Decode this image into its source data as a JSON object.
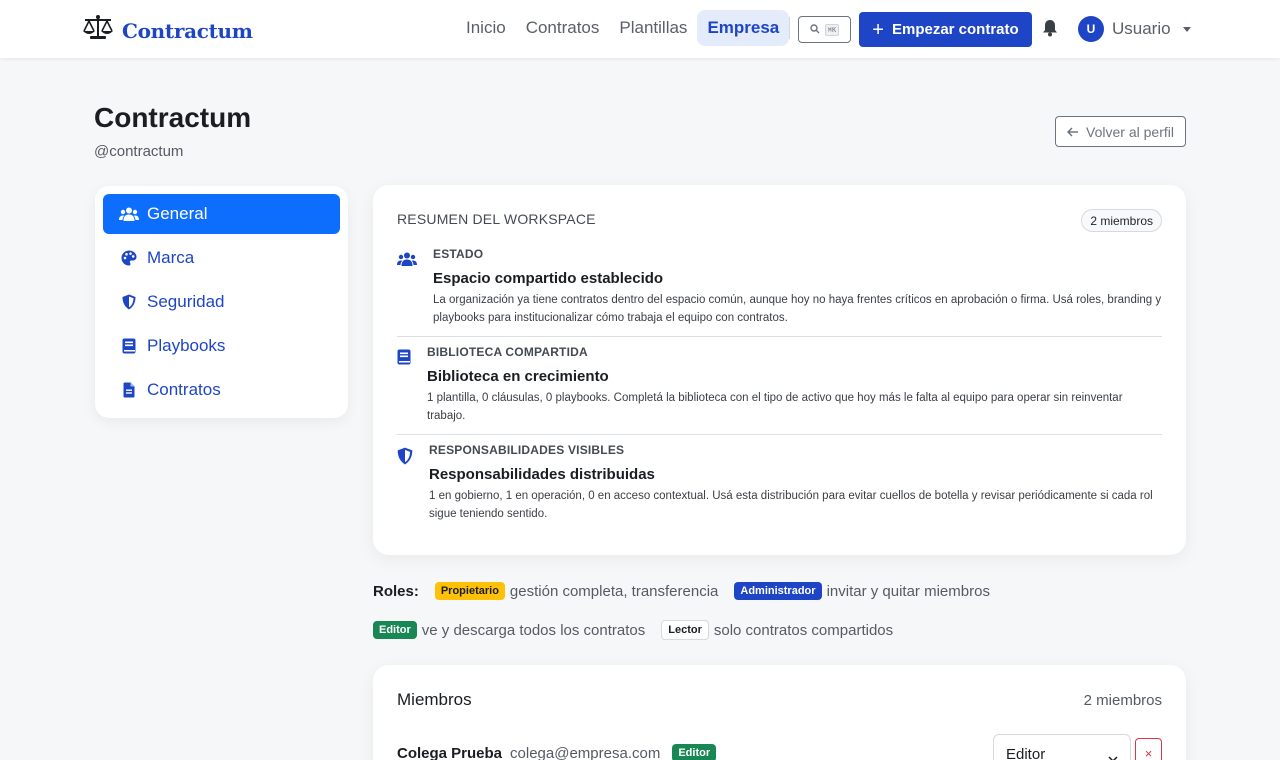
{
  "brand": {
    "name": "Contractum",
    "icon": "scales-icon",
    "color": "#1f45c7"
  },
  "nav": {
    "links": [
      {
        "label": "Inicio",
        "active": false
      },
      {
        "label": "Contratos",
        "active": false
      },
      {
        "label": "Plantillas",
        "active": false
      },
      {
        "label": "Empresa",
        "active": true
      }
    ],
    "search_shortcut": "⌘K",
    "start_button": "Empezar contrato",
    "user_initial": "U",
    "user_name": "Usuario"
  },
  "header": {
    "title": "Contractum",
    "handle": "@contractum",
    "back_button": "Volver al perfil"
  },
  "sidebar": {
    "items": [
      {
        "label": "General",
        "icon": "users-icon",
        "active": true
      },
      {
        "label": "Marca",
        "icon": "palette-icon",
        "active": false
      },
      {
        "label": "Seguridad",
        "icon": "shield-icon",
        "active": false
      },
      {
        "label": "Playbooks",
        "icon": "book-icon",
        "active": false
      },
      {
        "label": "Contratos",
        "icon": "file-icon",
        "active": false
      }
    ]
  },
  "summary": {
    "heading": "RESUMEN DEL WORKSPACE",
    "members_pill": "2 miembros",
    "items": [
      {
        "icon": "users-icon",
        "label": "ESTADO",
        "title": "Espacio compartido establecido",
        "description": "La organización ya tiene contratos dentro del espacio común, aunque hoy no haya frentes críticos en aprobación o firma. Usá roles, branding y playbooks para institucionalizar cómo trabaja el equipo con contratos."
      },
      {
        "icon": "book-icon",
        "label": "BIBLIOTECA COMPARTIDA",
        "title": "Biblioteca en crecimiento",
        "description": "1 plantilla, 0 cláusulas, 0 playbooks. Completá la biblioteca con el tipo de activo que hoy más le falta al equipo para operar sin reinventar trabajo."
      },
      {
        "icon": "shield-icon",
        "label": "RESPONSABILIDADES VISIBLES",
        "title": "Responsabilidades distribuidas",
        "description": "1 en gobierno, 1 en operación, 0 en acceso contextual. Usá esta distribución para evitar cuellos de botella y revisar periódicamente si cada rol sigue teniendo sentido."
      }
    ]
  },
  "roles": {
    "label": "Roles:",
    "items": [
      {
        "badge": "Propietario",
        "description": "gestión completa, transferencia",
        "color": "#ffc107"
      },
      {
        "badge": "Administrador",
        "description": "invitar y quitar miembros",
        "color": "#1f45c7"
      },
      {
        "badge": "Editor",
        "description": "ve y descarga todos los contratos",
        "color": "#198754"
      },
      {
        "badge": "Lector",
        "description": "solo contratos compartidos",
        "color": "#ffffff"
      }
    ]
  },
  "members": {
    "title": "Miembros",
    "count": "2 miembros",
    "rows": [
      {
        "name": "Colega Prueba",
        "email": "colega@empresa.com",
        "badge": "Editor",
        "role_value": "Editor",
        "remove": "×"
      }
    ]
  }
}
